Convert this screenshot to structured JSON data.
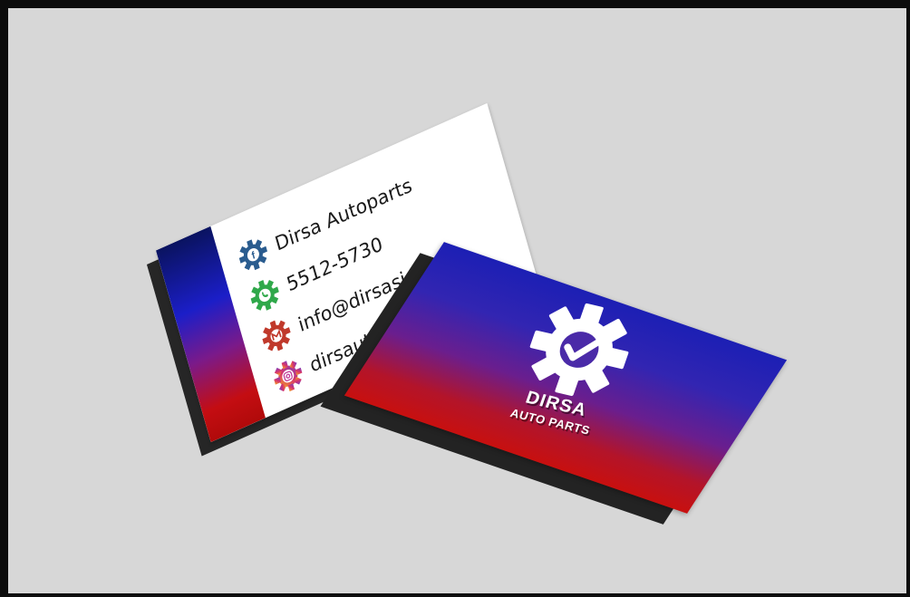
{
  "scene": {
    "background_color": "#d7d7d7",
    "frame_color": "#0c0c0c"
  },
  "back_card": {
    "stripe_colors": [
      "#0a1360",
      "#1b1ec8",
      "#7a1a8a",
      "#c40d12"
    ],
    "contacts": [
      {
        "icon": "facebook-gear-icon",
        "color": "#2a5c8f",
        "text": "Dirsa Autoparts"
      },
      {
        "icon": "whatsapp-gear-icon",
        "color": "#2fa84a",
        "text": "5512-5730"
      },
      {
        "icon": "gmail-gear-icon",
        "color": "#c0392b",
        "text": "info@dirsasi.com"
      },
      {
        "icon": "instagram-gear-icon",
        "color": "#c2409a",
        "text": "dirsautop"
      }
    ]
  },
  "front_card": {
    "logo_icon": "gear-checkmark-icon",
    "brand_name": "DIRSA",
    "brand_sub": "AUTO PARTS",
    "gradient_colors": [
      "#1c1fb4",
      "#6a1e8e",
      "#c8100f"
    ]
  }
}
